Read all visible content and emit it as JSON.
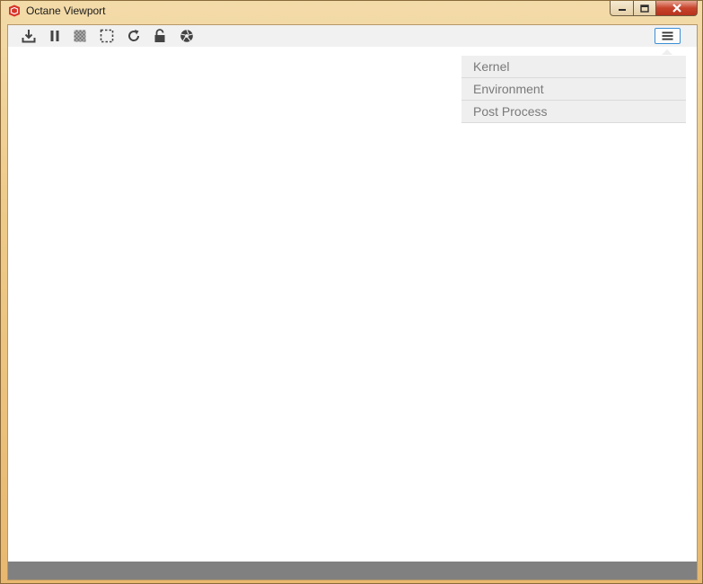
{
  "window": {
    "title": "Octane Viewport",
    "controls": [
      "minimize",
      "maximize",
      "close"
    ]
  },
  "toolbar": {
    "tools": [
      {
        "name": "save-render-icon",
        "tooltip": ""
      },
      {
        "name": "pause-icon",
        "tooltip": ""
      },
      {
        "name": "checkerboard-icon",
        "tooltip": ""
      },
      {
        "name": "region-select-icon",
        "tooltip": ""
      },
      {
        "name": "refresh-icon",
        "tooltip": ""
      },
      {
        "name": "lock-icon",
        "tooltip": ""
      },
      {
        "name": "aperture-icon",
        "tooltip": ""
      }
    ],
    "menu_icon": "hamburger-menu-icon"
  },
  "menu": {
    "items": [
      {
        "label": "Kernel"
      },
      {
        "label": "Environment"
      },
      {
        "label": "Post Process"
      }
    ]
  },
  "colors": {
    "frame": "#eecb8a",
    "toolbar": "#f1f1f1",
    "menu_bg": "#efefef",
    "menu_text": "#7a7a7a",
    "statusbar": "#808080",
    "focus": "#3b8fd6"
  }
}
